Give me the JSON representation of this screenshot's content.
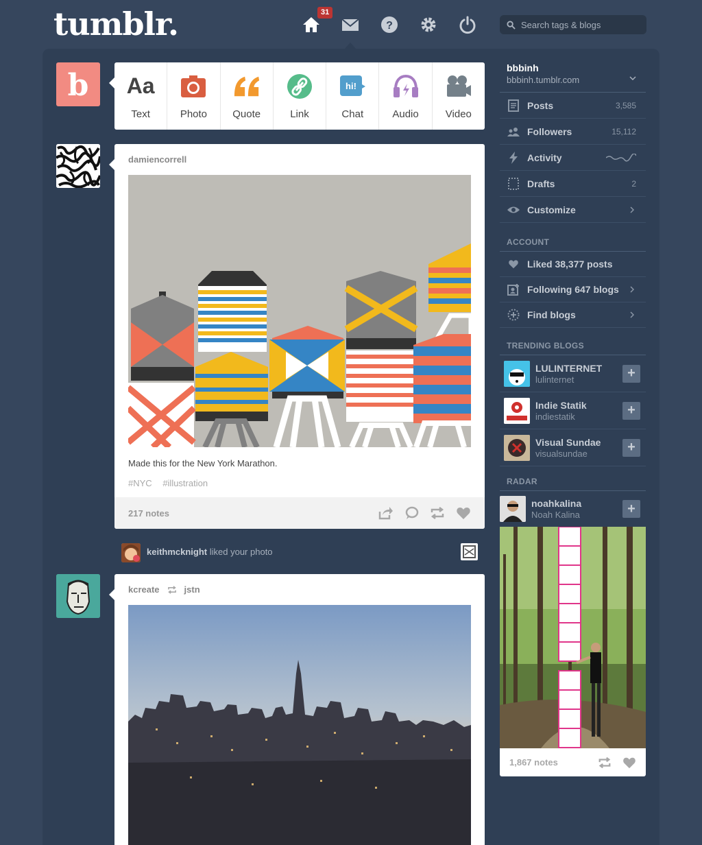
{
  "header": {
    "logo": "tumblr.",
    "notification_count": "31",
    "search_placeholder": "Search tags & blogs"
  },
  "post_types": [
    {
      "label": "Text",
      "icon": "text-icon",
      "color": "#444444"
    },
    {
      "label": "Photo",
      "icon": "camera-icon",
      "color": "#d95e40"
    },
    {
      "label": "Quote",
      "icon": "quote-icon",
      "color": "#f2992e"
    },
    {
      "label": "Link",
      "icon": "link-icon",
      "color": "#56bc8a"
    },
    {
      "label": "Chat",
      "icon": "chat-icon",
      "color": "#529ecc"
    },
    {
      "label": "Audio",
      "icon": "headphones-icon",
      "color": "#a77dc2"
    },
    {
      "label": "Video",
      "icon": "video-camera-icon",
      "color": "#748089"
    }
  ],
  "post_type_glyphs": {
    "text": "Aa",
    "chat": "hi!"
  },
  "posts": [
    {
      "author": "damiencorrell",
      "caption": "Made this for the New York Marathon.",
      "tags": [
        "#NYC",
        "#illustration"
      ],
      "notes": "217 notes"
    },
    {
      "author": "kcreate",
      "reblogged_from": "jstn"
    }
  ],
  "activity": {
    "user": "keithmcknight",
    "text": "liked your photo"
  },
  "sidebar": {
    "blog_name": "bbbinh",
    "blog_url": "bbbinh.tumblr.com",
    "stats": [
      {
        "label": "Posts",
        "value": "3,585",
        "icon": "posts-icon"
      },
      {
        "label": "Followers",
        "value": "15,112",
        "icon": "followers-icon"
      },
      {
        "label": "Activity",
        "value": "",
        "icon": "lightning-icon"
      },
      {
        "label": "Drafts",
        "value": "2",
        "icon": "drafts-icon"
      },
      {
        "label": "Customize",
        "value": "",
        "icon": "eye-icon"
      }
    ],
    "account_heading": "ACCOUNT",
    "account": [
      {
        "label": "Liked 38,377 posts",
        "icon": "heart-icon"
      },
      {
        "label": "Following 647 blogs",
        "icon": "following-icon"
      },
      {
        "label": "Find blogs",
        "icon": "find-blogs-icon"
      }
    ],
    "trending_heading": "TRENDING BLOGS",
    "trending": [
      {
        "name": "LULINTERNET",
        "url": "lulinternet"
      },
      {
        "name": "Indie Statik",
        "url": "indiestatik"
      },
      {
        "name": "Visual Sundae",
        "url": "visualsundae"
      }
    ],
    "radar_heading": "RADAR",
    "radar": {
      "name": "noahkalina",
      "full_name": "Noah Kalina",
      "notes": "1,867 notes"
    }
  },
  "colors": {
    "background": "#36465d",
    "panel": "#2f3f55",
    "badge": "#bc3533"
  }
}
